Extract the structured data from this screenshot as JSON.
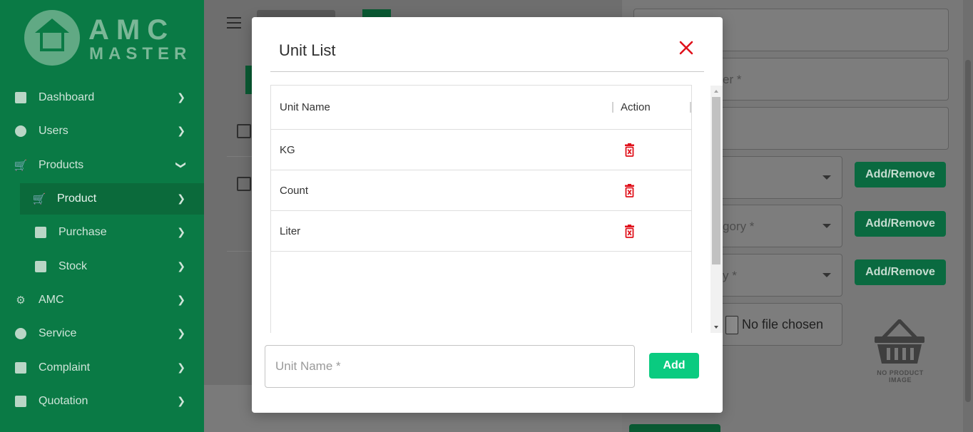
{
  "brand": {
    "top": "AMC",
    "bottom": "MASTER"
  },
  "sidebar": {
    "items": [
      {
        "label": "Dashboard",
        "icon": "dashboard-icon"
      },
      {
        "label": "Users",
        "icon": "users-icon"
      },
      {
        "label": "Products",
        "icon": "cart-icon"
      },
      {
        "label": "Product",
        "icon": "cart-icon"
      },
      {
        "label": "Purchase",
        "icon": "archive-icon"
      },
      {
        "label": "Stock",
        "icon": "store-icon"
      },
      {
        "label": "AMC",
        "icon": "gears-icon"
      },
      {
        "label": "Service",
        "icon": "support-icon"
      },
      {
        "label": "Complaint",
        "icon": "complaint-icon"
      },
      {
        "label": "Quotation",
        "icon": "document-icon"
      }
    ]
  },
  "drawer": {
    "field_2_label": "er *",
    "category_label": "gory *",
    "field_6_label": "y *",
    "add_remove_label": "Add/Remove",
    "file_status": "No file chosen",
    "no_image_label": "NO PRODUCT IMAGE"
  },
  "modal": {
    "title": "Unit List",
    "columns": {
      "name": "Unit Name",
      "action": "Action"
    },
    "rows": [
      {
        "name": "KG"
      },
      {
        "name": "Count"
      },
      {
        "name": "Liter"
      }
    ],
    "input_placeholder": "Unit Name *",
    "input_value": "",
    "add_label": "Add",
    "accent_color": "#0acb80",
    "delete_color": "#e0111b"
  }
}
